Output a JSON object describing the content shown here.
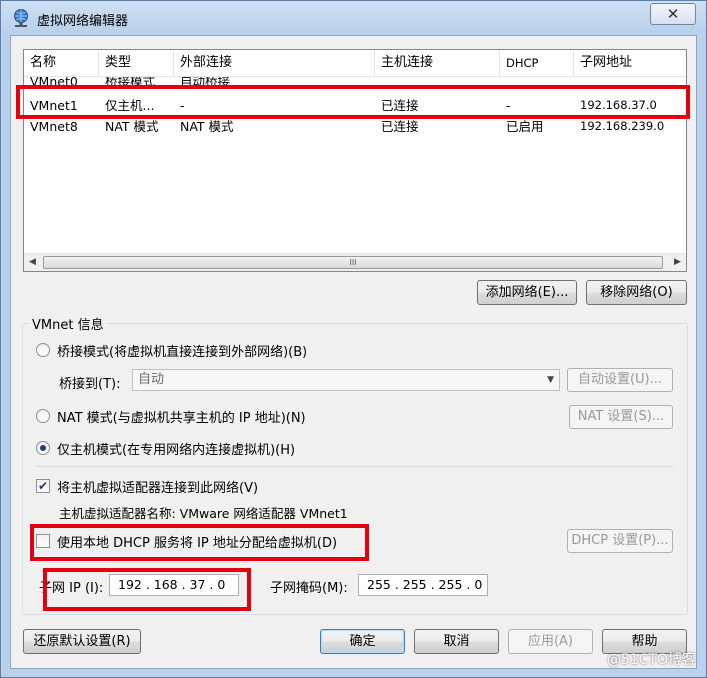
{
  "window": {
    "title": "虚拟网络编辑器",
    "close_label": "✕"
  },
  "columns": [
    "名称",
    "类型",
    "外部连接",
    "主机连接",
    "DHCP",
    "子网地址"
  ],
  "networks": [
    {
      "name": "VMnet0",
      "type": "桥接模式",
      "external": "自动桥接",
      "host": "",
      "dhcp": "",
      "subnet": ""
    },
    {
      "name": "VMnet1",
      "type": "仅主机...",
      "external": "-",
      "host": "已连接",
      "dhcp": "-",
      "subnet": "192.168.37.0"
    },
    {
      "name": "VMnet8",
      "type": "NAT 模式",
      "external": "NAT 模式",
      "host": "已连接",
      "dhcp": "已启用",
      "subnet": "192.168.239.0"
    }
  ],
  "scrollbar": {
    "left_arrow": "◀",
    "right_arrow": "▶",
    "grip": "III"
  },
  "buttons": {
    "add_network": "添加网络(E)...",
    "remove_network": "移除网络(O)",
    "restore_defaults": "还原默认设置(R)",
    "ok": "确定",
    "cancel": "取消",
    "apply": "应用(A)",
    "help": "帮助"
  },
  "vmnet_info": {
    "group_label": "VMnet 信息",
    "bridged_label": "桥接模式(将虚拟机直接连接到外部网络)(B)",
    "bridged_to_label": "桥接到(T):",
    "bridged_to_value": "自动",
    "auto_settings": "自动设置(U)...",
    "nat_label": "NAT 模式(与虚拟机共享主机的 IP 地址)(N)",
    "nat_settings": "NAT 设置(S)...",
    "hostonly_label": "仅主机模式(在专用网络内连接虚拟机)(H)",
    "selected_mode": "hostonly",
    "connect_adapter_label": "将主机虚拟适配器连接到此网络(V)",
    "connect_adapter_checked": true,
    "adapter_name_text": "主机虚拟适配器名称: VMware 网络适配器 VMnet1",
    "dhcp_label": "使用本地 DHCP 服务将 IP 地址分配给虚拟机(D)",
    "dhcp_checked": false,
    "dhcp_settings": "DHCP 设置(P)...",
    "subnet_ip_label": "子网 IP (I):",
    "subnet_ip_value": "192 . 168 . 37 . 0",
    "subnet_mask_label": "子网掩码(M):",
    "subnet_mask_value": "255 . 255 . 255 . 0"
  },
  "watermark": "@51CTO博客",
  "colors": {
    "highlight": "#e3000f",
    "title_bg": "#b9d1ea",
    "client_bg": "#f0f0f0"
  }
}
